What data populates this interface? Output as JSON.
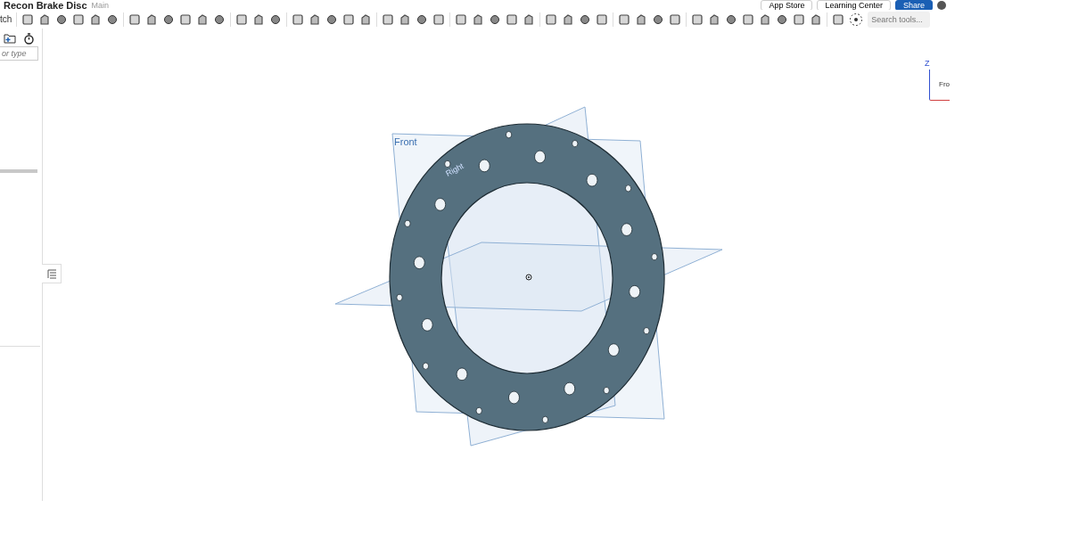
{
  "document": {
    "title": "Recon Brake Disc",
    "branch": "Main"
  },
  "header_buttons": [
    {
      "label": "App Store",
      "kind": "plain"
    },
    {
      "label": "Learning Center",
      "kind": "plain"
    },
    {
      "label": "Share",
      "kind": "primary"
    }
  ],
  "toolbar": {
    "sketch_label": "tch",
    "search": {
      "placeholder": "Search tools..."
    }
  },
  "feature_panel": {
    "filter": {
      "placeholder": "or type"
    }
  },
  "viewport": {
    "plane_labels": [
      "Front",
      "Right"
    ],
    "view_cube": {
      "face_label": "Fro",
      "axis_label": "Z"
    }
  }
}
